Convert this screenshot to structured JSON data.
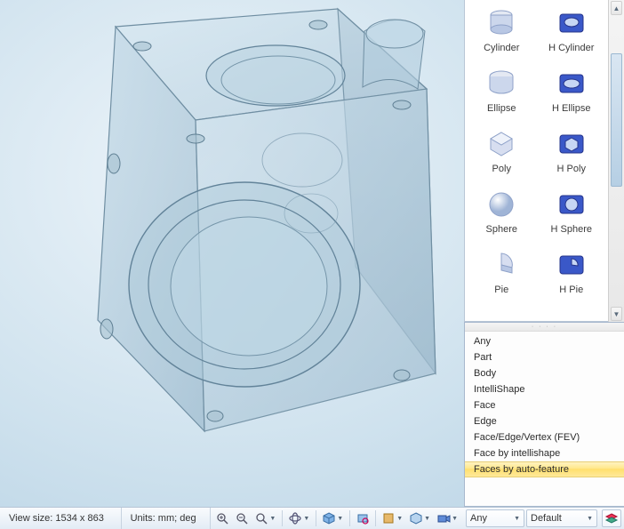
{
  "shapes": [
    {
      "id": "cylinder",
      "label": "Cylinder"
    },
    {
      "id": "hcylinder",
      "label": "H Cylinder"
    },
    {
      "id": "ellipse",
      "label": "Ellipse"
    },
    {
      "id": "hellipse",
      "label": "H Ellipse"
    },
    {
      "id": "poly",
      "label": "Poly"
    },
    {
      "id": "hpoly",
      "label": "H Poly"
    },
    {
      "id": "sphere",
      "label": "Sphere"
    },
    {
      "id": "hsphere",
      "label": "H Sphere"
    },
    {
      "id": "pie",
      "label": "Pie"
    },
    {
      "id": "hpie",
      "label": "H Pie"
    }
  ],
  "filters": [
    {
      "label": "Any",
      "selected": false
    },
    {
      "label": "Part",
      "selected": false
    },
    {
      "label": "Body",
      "selected": false
    },
    {
      "label": "IntelliShape",
      "selected": false
    },
    {
      "label": "Face",
      "selected": false
    },
    {
      "label": "Edge",
      "selected": false
    },
    {
      "label": "Face/Edge/Vertex (FEV)",
      "selected": false
    },
    {
      "label": "Face by intellishape",
      "selected": false
    },
    {
      "label": "Faces by auto-feature",
      "selected": true
    }
  ],
  "status": {
    "view_size": "View size: 1534 x  863",
    "units": "Units: mm; deg"
  },
  "selection_dropdowns": {
    "filter": "Any",
    "layer": "Default"
  },
  "grip_dots": "· · · ·"
}
